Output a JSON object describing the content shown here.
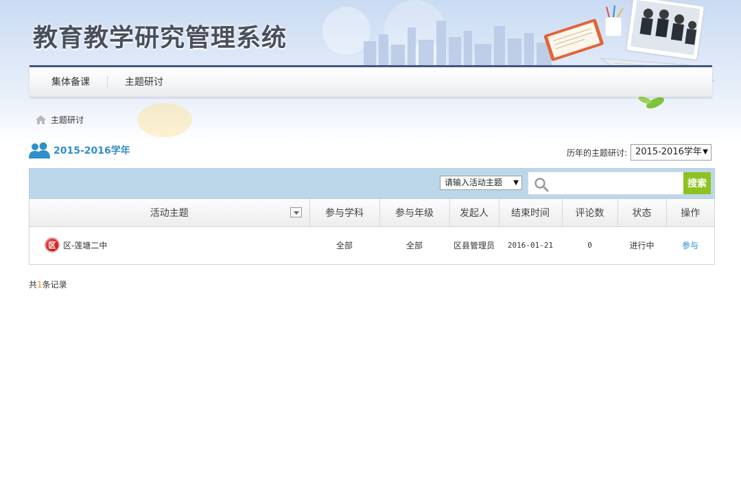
{
  "header": {
    "site_title": "教育教学研究管理系统"
  },
  "nav": {
    "items": [
      {
        "label": "集体备课"
      },
      {
        "label": "主题研讨"
      }
    ]
  },
  "breadcrumb": {
    "current": "主题研讨"
  },
  "year_section": {
    "label": "2015-2016学年",
    "history_label": "历年的主题研讨:",
    "history_selected": "2015-2016学年"
  },
  "search": {
    "topic_select": "请输入活动主题",
    "input_value": "",
    "button_label": "搜索"
  },
  "table": {
    "columns": [
      "活动主题",
      "参与学科",
      "参与年级",
      "发起人",
      "结束时间",
      "评论数",
      "状态",
      "操作"
    ],
    "rows": [
      {
        "badge": "区",
        "topic": "区-莲塘二中",
        "subject": "全部",
        "grade": "全部",
        "initiator": "区县管理员",
        "end_time": "2016-01-21",
        "comments": "0",
        "status": "进行中",
        "action": "参与"
      }
    ]
  },
  "footer": {
    "records_prefix": "共",
    "records_count": "1",
    "records_suffix": "条记录"
  },
  "colors": {
    "nav_border": "#3d5580",
    "accent_blue": "#2f8fc9",
    "search_bar": "#bcd7ea",
    "search_button": "#8dc21f",
    "badge_red": "#c91818",
    "count_orange": "#f08519"
  }
}
